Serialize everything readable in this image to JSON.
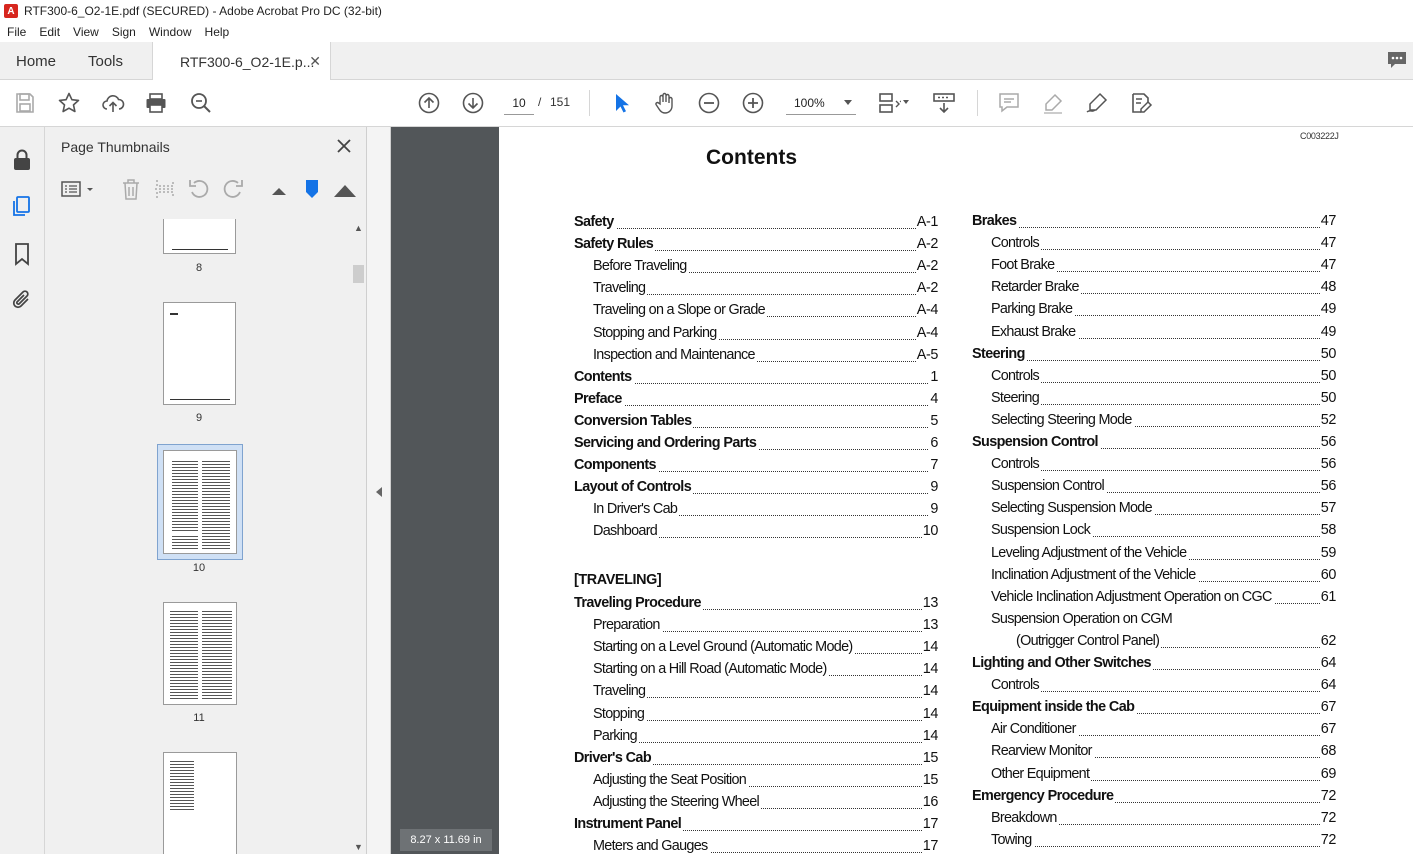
{
  "window": {
    "title": "RTF300-6_O2-1E.pdf (SECURED) - Adobe Acrobat Pro DC (32-bit)"
  },
  "menu": [
    "File",
    "Edit",
    "View",
    "Sign",
    "Window",
    "Help"
  ],
  "tabs": {
    "home": "Home",
    "tools": "Tools",
    "document": "RTF300-6_O2-1E.p..."
  },
  "toolbar": {
    "page_current": "10",
    "page_separator": "/",
    "page_total": "151",
    "zoom": "100%"
  },
  "thumbnails_panel": {
    "title": "Page Thumbnails",
    "pages": [
      "8",
      "9",
      "10",
      "11"
    ],
    "selected": "10"
  },
  "viewer": {
    "page_size": "8.27 x 11.69 in"
  },
  "document": {
    "code": "C003222J",
    "title": "Contents",
    "section_traveling": "[TRAVELING]",
    "left_column": [
      {
        "label": "Safety",
        "page": "A-1",
        "bold": true
      },
      {
        "label": "Safety Rules",
        "page": "A-2",
        "bold": true
      },
      {
        "label": "Before Traveling",
        "page": "A-2",
        "bold": false
      },
      {
        "label": "Traveling",
        "page": "A-2",
        "bold": false
      },
      {
        "label": "Traveling on a Slope or Grade",
        "page": "A-4",
        "bold": false
      },
      {
        "label": "Stopping and Parking",
        "page": "A-4",
        "bold": false
      },
      {
        "label": "Inspection and Maintenance",
        "page": "A-5",
        "bold": false
      },
      {
        "label": "Contents",
        "page": "1",
        "bold": true
      },
      {
        "label": "Preface",
        "page": "4",
        "bold": true
      },
      {
        "label": "Conversion Tables",
        "page": "5",
        "bold": true
      },
      {
        "label": "Servicing and Ordering Parts",
        "page": "6",
        "bold": true
      },
      {
        "label": "Components",
        "page": "7",
        "bold": true
      },
      {
        "label": "Layout of Controls",
        "page": "9",
        "bold": true
      },
      {
        "label": "In Driver's Cab",
        "page": "9",
        "bold": false
      },
      {
        "label": "Dashboard",
        "page": "10",
        "bold": false
      }
    ],
    "left_column_2": [
      {
        "label": "Traveling Procedure",
        "page": "13",
        "bold": true
      },
      {
        "label": "Preparation",
        "page": "13",
        "bold": false
      },
      {
        "label": "Starting on a Level Ground (Automatic Mode)",
        "page": "14",
        "bold": false
      },
      {
        "label": "Starting on a Hill Road (Automatic Mode)",
        "page": "14",
        "bold": false
      },
      {
        "label": "Traveling",
        "page": "14",
        "bold": false
      },
      {
        "label": "Stopping",
        "page": "14",
        "bold": false
      },
      {
        "label": "Parking",
        "page": "14",
        "bold": false
      },
      {
        "label": "Driver's Cab",
        "page": "15",
        "bold": true
      },
      {
        "label": "Adjusting the Seat Position",
        "page": "15",
        "bold": false
      },
      {
        "label": "Adjusting the Steering Wheel",
        "page": "16",
        "bold": false
      },
      {
        "label": "Instrument Panel",
        "page": "17",
        "bold": true
      },
      {
        "label": "Meters and Gauges",
        "page": "17",
        "bold": false
      }
    ],
    "right_column": [
      {
        "label": "Brakes",
        "page": "47",
        "bold": true
      },
      {
        "label": "Controls",
        "page": "47",
        "bold": false
      },
      {
        "label": "Foot Brake",
        "page": "47",
        "bold": false
      },
      {
        "label": "Retarder Brake",
        "page": "48",
        "bold": false
      },
      {
        "label": "Parking Brake",
        "page": "49",
        "bold": false
      },
      {
        "label": "Exhaust Brake",
        "page": "49",
        "bold": false
      },
      {
        "label": "Steering",
        "page": "50",
        "bold": true
      },
      {
        "label": "Controls",
        "page": "50",
        "bold": false
      },
      {
        "label": "Steering",
        "page": "50",
        "bold": false
      },
      {
        "label": "Selecting Steering Mode",
        "page": "52",
        "bold": false
      },
      {
        "label": "Suspension Control",
        "page": "56",
        "bold": true
      },
      {
        "label": "Controls",
        "page": "56",
        "bold": false
      },
      {
        "label": "Suspension Control",
        "page": "56",
        "bold": false
      },
      {
        "label": "Selecting Suspension Mode",
        "page": "57",
        "bold": false
      },
      {
        "label": "Suspension Lock",
        "page": "58",
        "bold": false
      },
      {
        "label": "Leveling Adjustment of the Vehicle",
        "page": "59",
        "bold": false
      },
      {
        "label": "Inclination Adjustment of the Vehicle",
        "page": "60",
        "bold": false
      },
      {
        "label": "Vehicle Inclination Adjustment Operation on CGC",
        "page": "61",
        "bold": false
      },
      {
        "label": "Suspension Operation on CGM",
        "page": "",
        "bold": false
      },
      {
        "label": "(Outrigger Control Panel)",
        "page": "62",
        "bold": false
      },
      {
        "label": "Lighting and Other Switches",
        "page": "64",
        "bold": true
      },
      {
        "label": "Controls",
        "page": "64",
        "bold": false
      },
      {
        "label": "Equipment inside the Cab",
        "page": "67",
        "bold": true
      },
      {
        "label": "Air Conditioner",
        "page": "67",
        "bold": false
      },
      {
        "label": "Rearview Monitor",
        "page": "68",
        "bold": false
      },
      {
        "label": "Other Equipment",
        "page": "69",
        "bold": false
      },
      {
        "label": "Emergency Procedure",
        "page": "72",
        "bold": true
      },
      {
        "label": "Breakdown",
        "page": "72",
        "bold": false
      },
      {
        "label": "Towing",
        "page": "72",
        "bold": false
      }
    ]
  }
}
